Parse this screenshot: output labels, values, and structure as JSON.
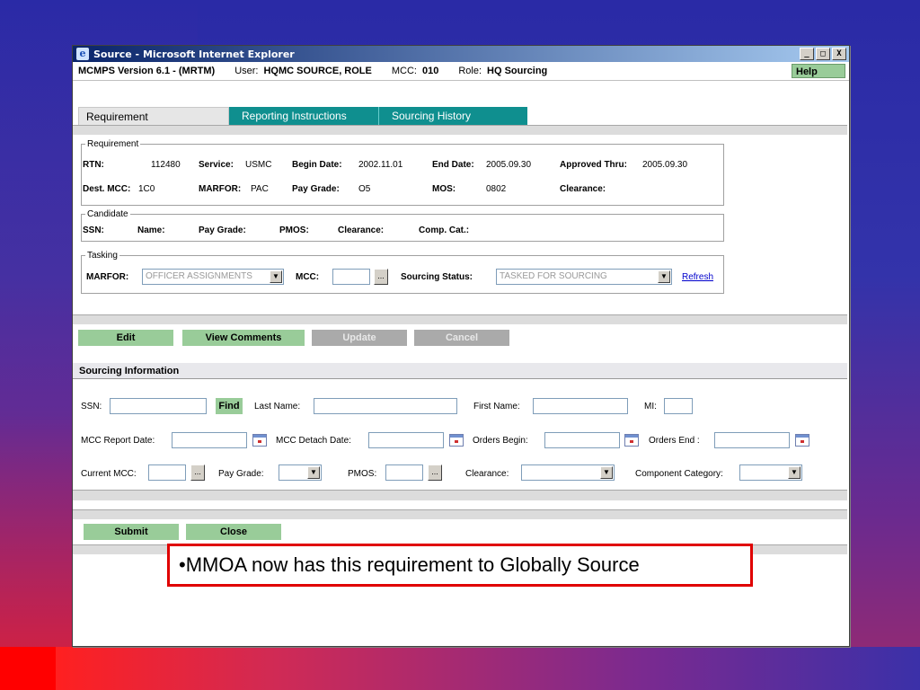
{
  "window": {
    "title": "Source - Microsoft Internet Explorer",
    "ie_logo_glyph": "e",
    "controls": {
      "minimize": "_",
      "maximize": "□",
      "close": "X"
    }
  },
  "header": {
    "app_version": "MCMPS Version 6.1 - (MRTM)",
    "user_label": "User:",
    "user_value": "HQMC SOURCE, ROLE",
    "mcc_label": "MCC:",
    "mcc_value": "010",
    "role_label": "Role:",
    "role_value": "HQ Sourcing",
    "help_label": "Help"
  },
  "tabs": [
    {
      "label": "Requirement"
    },
    {
      "label": "Reporting Instructions"
    },
    {
      "label": "Sourcing History"
    }
  ],
  "requirement": {
    "legend": "Requirement",
    "rtn_label": "RTN:",
    "rtn": "112480",
    "service_label": "Service:",
    "service": "USMC",
    "begin_label": "Begin Date:",
    "begin": "2002.11.01",
    "end_label": "End Date:",
    "end": "2005.09.30",
    "approved_label": "Approved Thru:",
    "approved": "2005.09.30",
    "dest_label": "Dest. MCC:",
    "dest": "1C0",
    "marfor_label": "MARFOR:",
    "marfor": "PAC",
    "paygrade_label": "Pay Grade:",
    "paygrade": "O5",
    "mos_label": "MOS:",
    "mos": "0802",
    "clearance_label": "Clearance:"
  },
  "candidate": {
    "legend": "Candidate",
    "ssn_label": "SSN:",
    "name_label": "Name:",
    "paygrade_label": "Pay Grade:",
    "pmos_label": "PMOS:",
    "clearance_label": "Clearance:",
    "compcat_label": "Comp. Cat.:"
  },
  "tasking": {
    "legend": "Tasking",
    "marfor_label": "MARFOR:",
    "marfor_value": "OFFICER ASSIGNMENTS",
    "mcc_label": "MCC:",
    "dots": "...",
    "status_label": "Sourcing Status:",
    "status_value": "TASKED FOR SOURCING",
    "refresh_label": "Refresh",
    "arrow": "▼"
  },
  "actions": {
    "edit": "Edit",
    "view_comments": "View Comments",
    "update": "Update",
    "cancel": "Cancel"
  },
  "sourcing": {
    "heading": "Sourcing Information",
    "ssn_label": "SSN:",
    "find_label": "Find",
    "last_name_label": "Last Name:",
    "first_name_label": "First Name:",
    "mi_label": "MI:",
    "report_date_label": "MCC Report Date:",
    "detach_date_label": "MCC Detach Date:",
    "orders_begin_label": "Orders Begin:",
    "orders_end_label": "Orders End :",
    "current_mcc_label": "Current MCC:",
    "paygrade_label": "Pay Grade:",
    "pmos_label": "PMOS:",
    "clearance_label": "Clearance:",
    "component_label": "Component Category:"
  },
  "footer": {
    "submit": "Submit",
    "close": "Close"
  },
  "callout": {
    "text": "•MMOA now has this requirement to Globally Source"
  },
  "colors": {
    "teal_tab": "#0f8f8f",
    "button_green": "#99cc99",
    "button_disabled": "#aaaaaa",
    "callout_border": "#e00000"
  }
}
